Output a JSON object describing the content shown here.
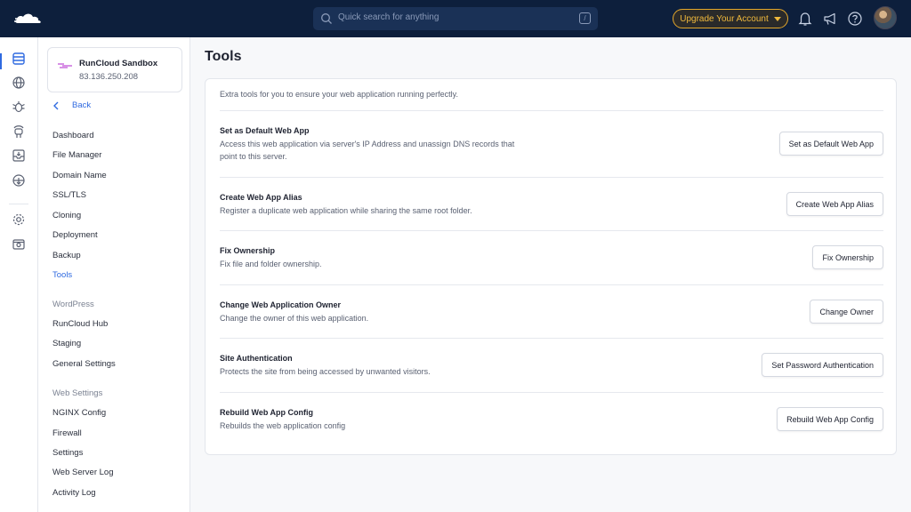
{
  "header": {
    "search_placeholder": "Quick search for anything",
    "search_shortcut": "/",
    "upgrade_label": "Upgrade Your Account",
    "icons": [
      "cloud-logo-icon",
      "search-icon",
      "bell-icon",
      "megaphone-icon",
      "help-icon"
    ],
    "colors": {
      "topbar": "#0d1f3c",
      "accent": "#2f6ae0",
      "upgrade": "#f0b93c"
    }
  },
  "rail": {
    "icons": [
      "servers-icon",
      "globe-icon",
      "bug-icon",
      "robot-icon",
      "inbox-icon",
      "cloud-sync-icon",
      "settings-icon",
      "credential-icon"
    ]
  },
  "sidebar": {
    "server_name": "RunCloud Sandbox",
    "server_ip": "83.136.250.208",
    "back_label": "Back",
    "items": [
      "Dashboard",
      "File Manager",
      "Domain Name",
      "SSL/TLS",
      "Cloning",
      "Deployment",
      "Backup",
      "Tools"
    ],
    "active_item": "Tools",
    "wordpress_heading": "WordPress",
    "wordpress_items": [
      "RunCloud Hub",
      "Staging",
      "General Settings"
    ],
    "webset_heading": "Web Settings",
    "webset_items": [
      "NGINX Config",
      "Firewall",
      "Settings",
      "Web Server Log",
      "Activity Log"
    ]
  },
  "main": {
    "title": "Tools",
    "intro": "Extra tools for you to ensure your web application running perfectly.",
    "tools": [
      {
        "title": "Set as Default Web App",
        "desc": "Access this web application via server's IP Address and unassign DNS records that point to this server.",
        "button": "Set as Default Web App"
      },
      {
        "title": "Create Web App Alias",
        "desc": "Register a duplicate web application while sharing the same root folder.",
        "button": "Create Web App Alias"
      },
      {
        "title": "Fix Ownership",
        "desc": "Fix file and folder ownership.",
        "button": "Fix Ownership"
      },
      {
        "title": "Change Web Application Owner",
        "desc": "Change the owner of this web application.",
        "button": "Change Owner"
      },
      {
        "title": "Site Authentication",
        "desc": "Protects the site from being accessed by unwanted visitors.",
        "button": "Set Password Authentication"
      },
      {
        "title": "Rebuild Web App Config",
        "desc": "Rebuilds the web application config",
        "button": "Rebuild Web App Config"
      }
    ]
  }
}
